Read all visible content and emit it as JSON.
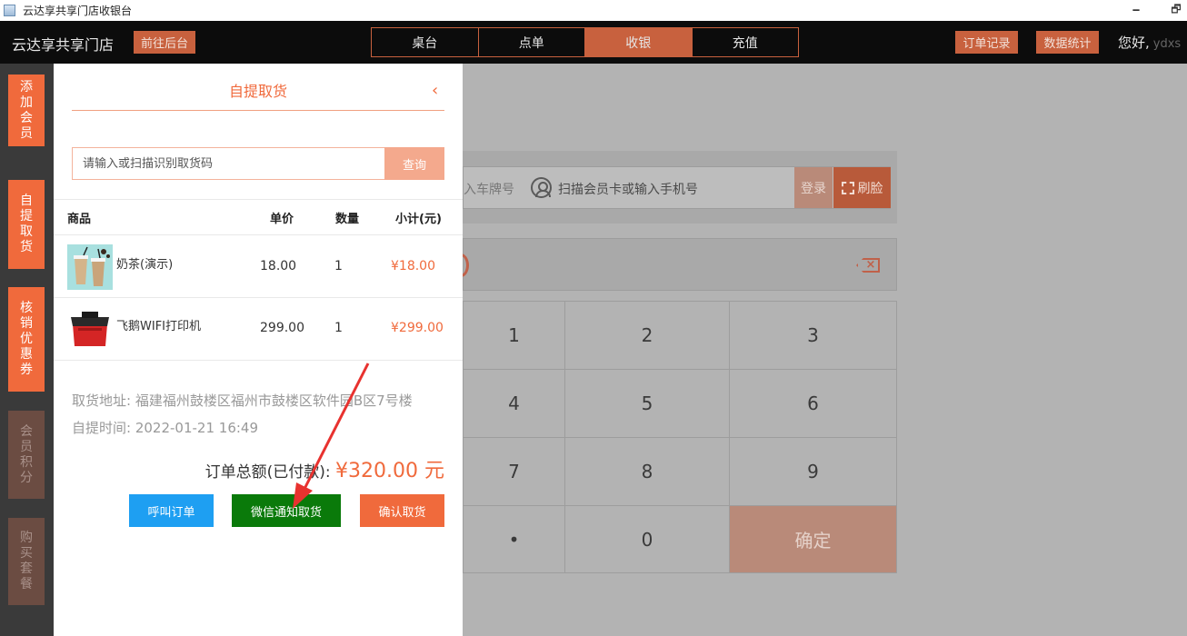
{
  "window": {
    "title": "云达享共享门店收银台",
    "min_glyph": "🗕",
    "max_glyph": "🗗"
  },
  "topbar": {
    "store_name": "云达享共享门店",
    "to_admin": "前往后台",
    "tabs": [
      "桌台",
      "点单",
      "收银",
      "充值"
    ],
    "active_tab": "收银",
    "order_records": "订单记录",
    "data_stats": "数据统计",
    "greeting": "您好,",
    "username": "ydxs"
  },
  "sidebar": {
    "items": [
      {
        "label": [
          "添",
          "加",
          "会",
          "员"
        ],
        "enabled": true
      },
      {
        "label": [
          "自",
          "提",
          "取",
          "货"
        ],
        "enabled": true
      },
      {
        "label": [
          "核",
          "销",
          "优",
          "惠",
          "券"
        ],
        "enabled": true
      },
      {
        "label": [
          "会",
          "员",
          "积",
          "分"
        ],
        "enabled": false
      },
      {
        "label": [
          "购",
          "买",
          "套",
          "餐"
        ],
        "enabled": false
      }
    ]
  },
  "cashier_bg": {
    "plate_placeholder": "入车牌号",
    "member_placeholder": "扫描会员卡或输入手机号",
    "login": "登录",
    "face_pay": "刷脸",
    "keys": [
      "1",
      "2",
      "3",
      "4",
      "5",
      "6",
      "7",
      "8",
      "9",
      "•",
      "0"
    ],
    "confirm": "确定"
  },
  "pickup_panel": {
    "title": "自提取货",
    "back_glyph": "‹",
    "search_placeholder": "请输入或扫描识别取货码",
    "search_button": "查询",
    "columns": {
      "product": "商品",
      "price": "单价",
      "qty": "数量",
      "subtotal": "小计(元)"
    },
    "items": [
      {
        "name": "奶茶(演示)",
        "price": "18.00",
        "qty": "1",
        "subtotal": "¥18.00"
      },
      {
        "name": "飞鹅WIFI打印机",
        "price": "299.00",
        "qty": "1",
        "subtotal": "¥299.00"
      }
    ],
    "address_label": "取货地址:",
    "address": "福建福州鼓楼区福州市鼓楼区软件园B区7号楼",
    "time_label": "自提时间:",
    "time": "2022-01-21 16:49",
    "total_label": "订单总额(已付款):",
    "total_amount": "¥320.00 元",
    "buttons": {
      "call": "呼叫订单",
      "wechat": "微信通知取货",
      "confirm": "确认取货"
    }
  },
  "annotation": {
    "arrow_color": "#e8322f"
  }
}
